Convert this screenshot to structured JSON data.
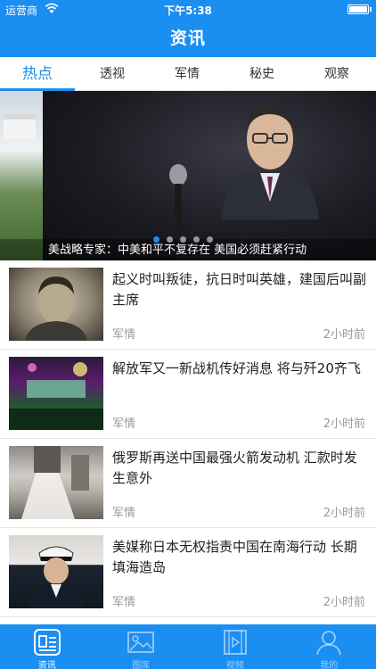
{
  "status_bar": {
    "carrier": "运营商",
    "time": "下午5:38"
  },
  "nav": {
    "title": "资讯"
  },
  "tabs": [
    {
      "label": "热点",
      "active": true
    },
    {
      "label": "透视",
      "active": false
    },
    {
      "label": "军情",
      "active": false
    },
    {
      "label": "秘史",
      "active": false
    },
    {
      "label": "观察",
      "active": false
    }
  ],
  "banner": {
    "caption": "美战略专家：中美和平不复存在 美国必须赶紧行动",
    "slide_count": 5,
    "active_slide": 1
  },
  "news": [
    {
      "headline": "起义时叫叛徒，抗日时叫英雄，建国后叫副主席",
      "category": "军情",
      "time": "2小时前"
    },
    {
      "headline": "解放军又一新战机传好消息 将与歼20齐飞",
      "category": "军情",
      "time": "2小时前"
    },
    {
      "headline": "俄罗斯再送中国最强火箭发动机 汇款时发生意外",
      "category": "军情",
      "time": "2小时前"
    },
    {
      "headline": "美媒称日本无权指责中国在南海行动 长期填海造岛",
      "category": "军情",
      "time": "2小时前"
    }
  ],
  "tab_bar": [
    {
      "label": "资讯",
      "icon": "news-icon",
      "active": true
    },
    {
      "label": "图库",
      "icon": "gallery-icon",
      "active": false
    },
    {
      "label": "视频",
      "icon": "video-icon",
      "active": false
    },
    {
      "label": "我的",
      "icon": "profile-icon",
      "active": false
    }
  ],
  "colors": {
    "primary": "#1b8ef2",
    "text": "#222222",
    "muted": "#9a9a9a"
  }
}
